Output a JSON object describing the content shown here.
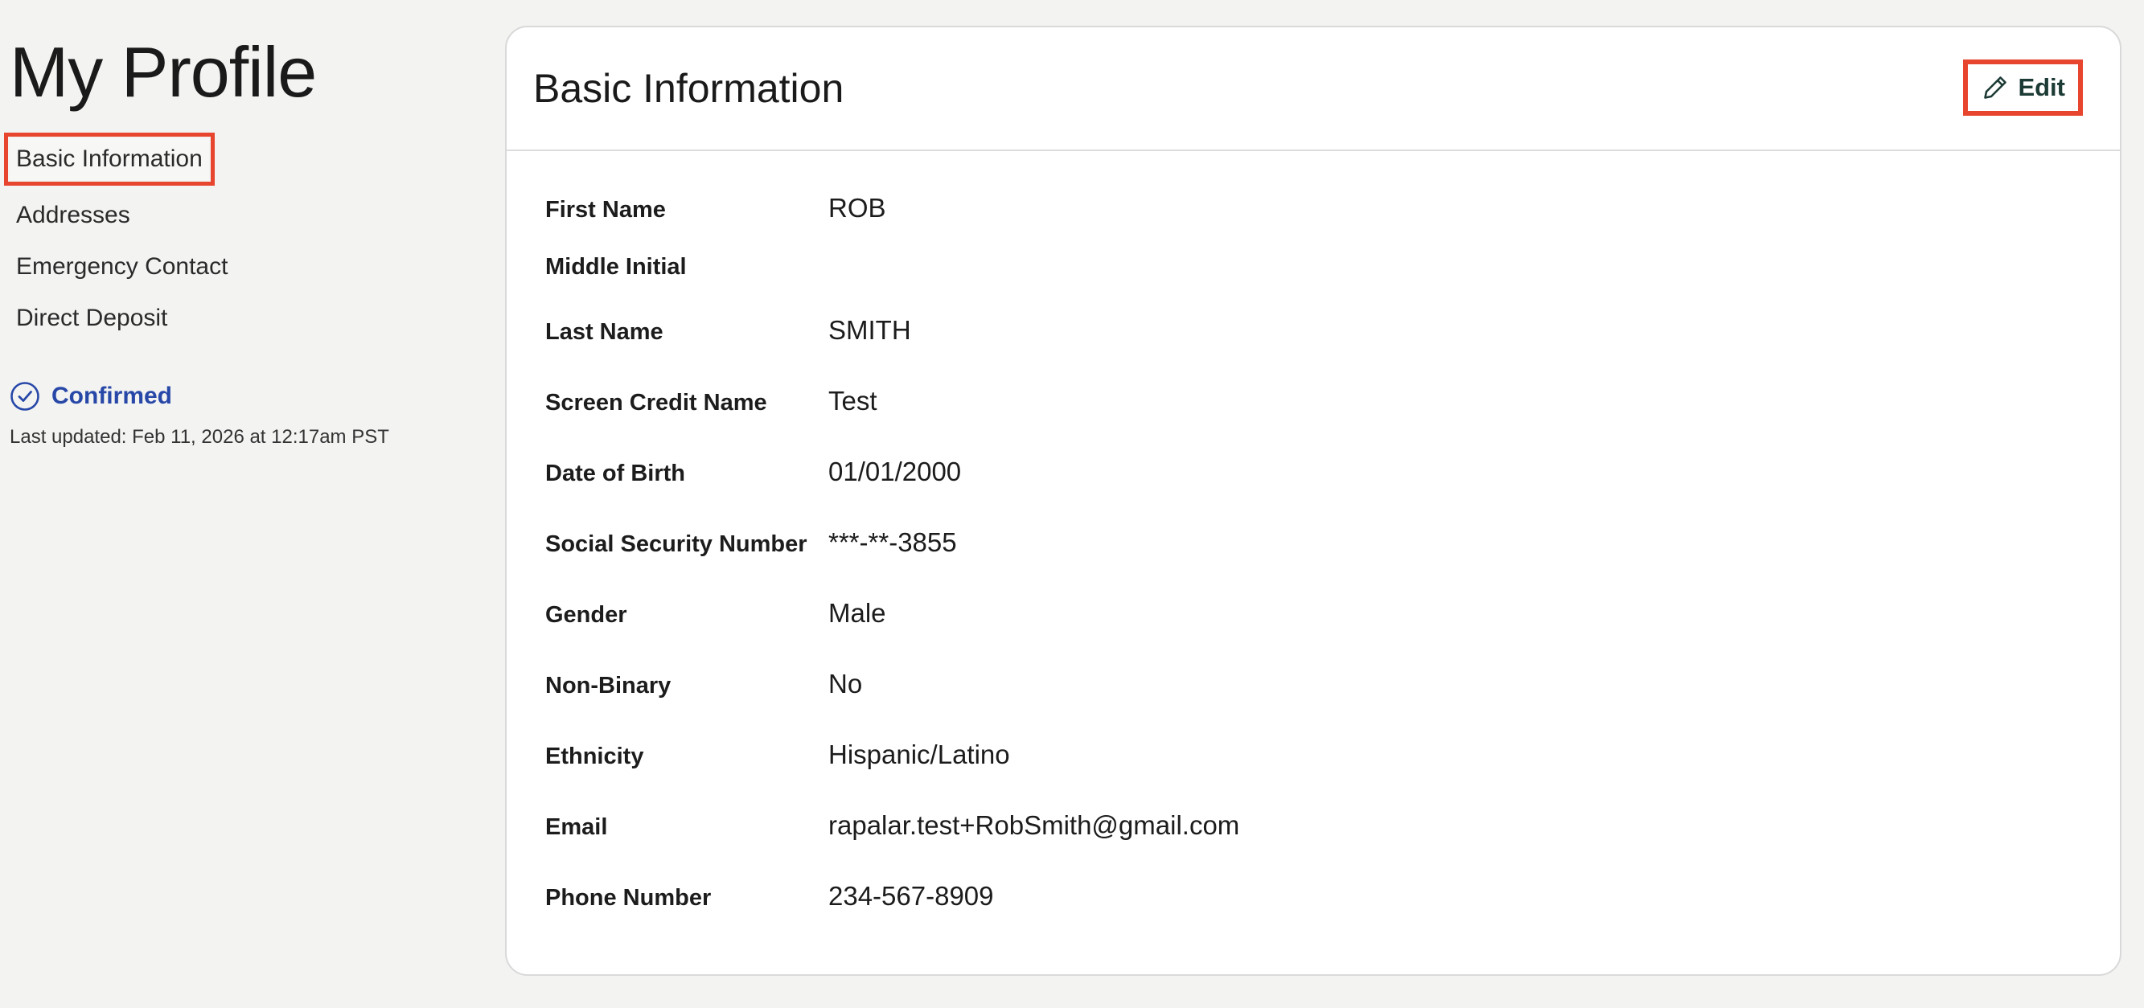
{
  "sidebar": {
    "title": "My Profile",
    "nav": [
      {
        "label": "Basic Information",
        "active": true
      },
      {
        "label": "Addresses",
        "active": false
      },
      {
        "label": "Emergency Contact",
        "active": false
      },
      {
        "label": "Direct Deposit",
        "active": false
      }
    ],
    "status": {
      "label": "Confirmed",
      "icon": "check-circle-icon",
      "color": "#2848a8"
    },
    "last_updated": "Last updated: Feb 11, 2026 at 12:17am PST"
  },
  "card": {
    "title": "Basic Information",
    "edit_label": "Edit",
    "edit_icon": "pencil-icon",
    "fields": [
      {
        "label": "First Name",
        "value": "ROB"
      },
      {
        "label": "Middle Initial",
        "value": ""
      },
      {
        "label": "Last Name",
        "value": "SMITH"
      },
      {
        "label": "Screen Credit Name",
        "value": "Test"
      },
      {
        "label": "Date of Birth",
        "value": "01/01/2000"
      },
      {
        "label": "Social Security Number",
        "value": "***-**-3855"
      },
      {
        "label": "Gender",
        "value": "Male"
      },
      {
        "label": "Non-Binary",
        "value": "No"
      },
      {
        "label": "Ethnicity",
        "value": "Hispanic/Latino"
      },
      {
        "label": "Email",
        "value": "rapalar.test+RobSmith@gmail.com"
      },
      {
        "label": "Phone Number",
        "value": "234-567-8909"
      }
    ]
  },
  "colors": {
    "highlight": "#e7452e",
    "accent": "#2848a8",
    "edit_text": "#1d3b35"
  }
}
